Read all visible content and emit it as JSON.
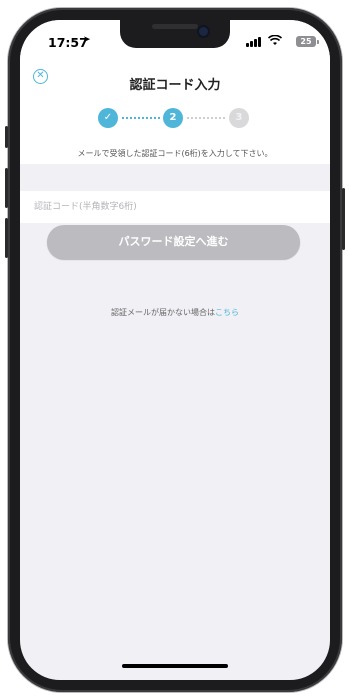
{
  "status_bar": {
    "time": "17:57",
    "battery": "25"
  },
  "header": {
    "title": "認証コード入力",
    "steps": [
      "2",
      "3"
    ]
  },
  "instruction": "メールで受領した認証コード(6桁)を入力して下さい。",
  "form": {
    "code_placeholder": "認証コード(半角数字6桁)",
    "submit_label": "パスワード設定へ進む"
  },
  "help": {
    "text": "認証メールが届かない場合は",
    "link": "こちら"
  },
  "colors": {
    "accent": "#4fb6d9",
    "disabled_button": "#bbbbc0",
    "background": "#f0f0f5"
  }
}
